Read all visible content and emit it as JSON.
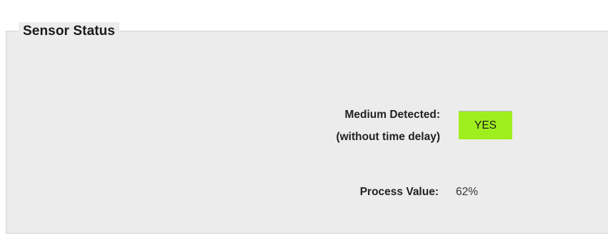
{
  "sensor_status": {
    "title": "Sensor Status",
    "medium_detected_label": "Medium Detected:",
    "medium_detected_sublabel": "(without time delay)",
    "medium_detected_value": "YES",
    "medium_detected_color": "#9fef1f",
    "process_value_label": "Process Value:",
    "process_value": "62%"
  }
}
